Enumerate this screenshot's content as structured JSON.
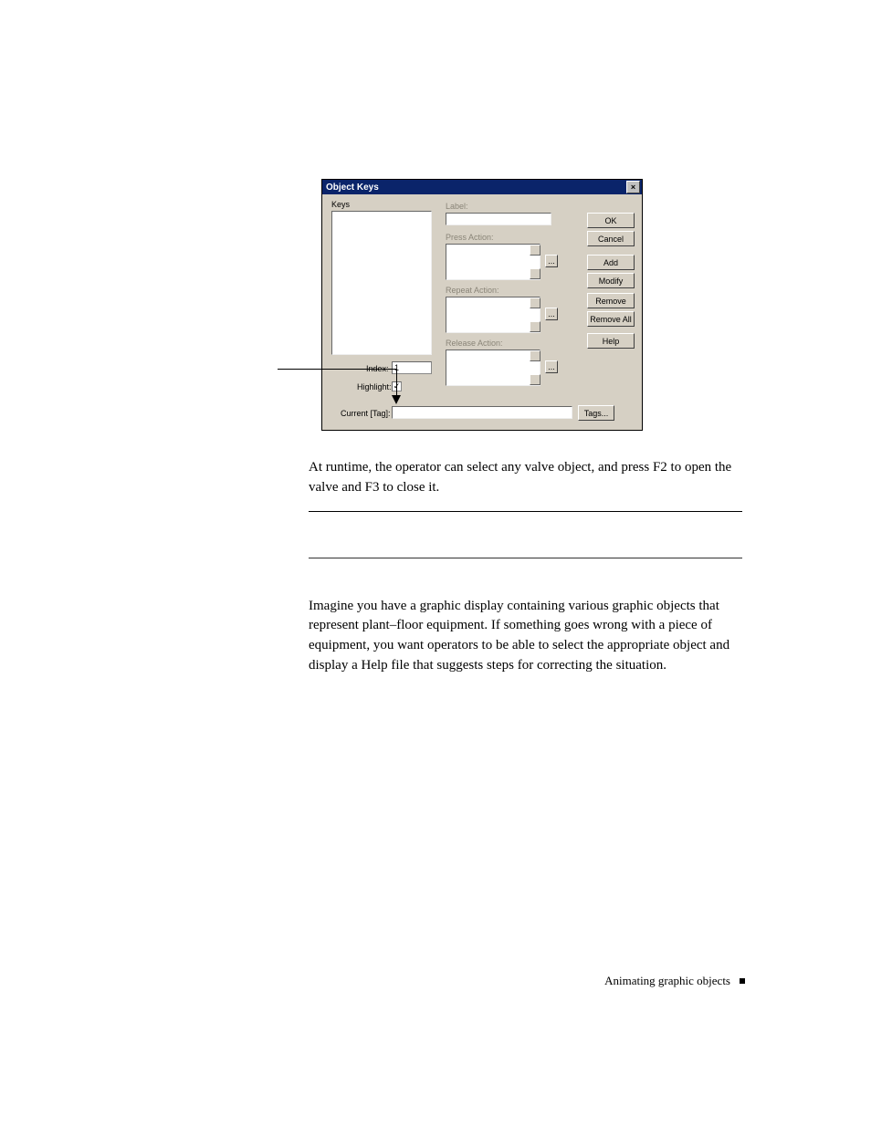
{
  "dialog": {
    "title": "Object Keys",
    "labels": {
      "keys": "Keys",
      "label": "Label:",
      "press": "Press Action:",
      "repeat": "Repeat Action:",
      "release": "Release Action:",
      "index": "Index:",
      "highlight": "Highlight:",
      "current": "Current [Tag]:"
    },
    "buttons": {
      "ok": "OK",
      "cancel": "Cancel",
      "add": "Add",
      "modify": "Modify",
      "remove": "Remove",
      "removeAll": "Remove All",
      "help": "Help",
      "ellipsis": "...",
      "tags": "Tags..."
    },
    "values": {
      "index": "1",
      "highlightChecked": "✓"
    }
  },
  "body": {
    "p1": "At runtime, the operator can select any valve object, and press F2 to open the valve and F3 to close it.",
    "p2": "Imagine you have a graphic display containing various graphic objects that represent plant–floor equipment. If something goes wrong with a piece of equipment, you want operators to be able to select the appropriate object and display a Help file that suggests steps for correcting the situation."
  },
  "footer": {
    "text": "Animating graphic objects"
  }
}
